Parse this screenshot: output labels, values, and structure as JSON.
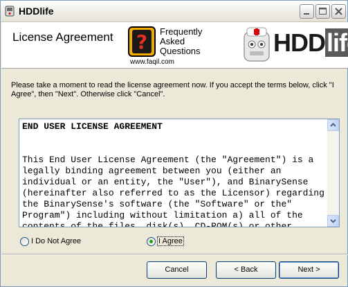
{
  "window": {
    "title": "HDDlife"
  },
  "header": {
    "title": "License Agreement",
    "faq": {
      "line1": "Frequently",
      "line2": "Asked",
      "line3": "Questions",
      "url": "www.faqil.com"
    },
    "logo": {
      "hdd": "HDD",
      "life": "life"
    }
  },
  "instructions": "Please take a moment to read the license agreement now. If you accept the terms below, click \"I Agree\", then \"Next\". Otherwise click \"Cancel\".",
  "license": {
    "title": "END USER LICENSE AGREEMENT",
    "body": "This End User License Agreement (the \"Agreement\") is a legally binding agreement between you (either an individual or an entity, the \"User\"), and BinarySense (hereinafter also referred to as the Licensor) regarding the BinarySense's software (the \"Software\" or the\" Program\") including without limitation a) all of the contents of the files, disk(s), CD-ROM(s) or other"
  },
  "options": {
    "disagree": "I Do Not Agree",
    "agree": "I Agree",
    "selected": "agree"
  },
  "buttons": {
    "cancel": "Cancel",
    "back": "< Back",
    "next": "Next >"
  },
  "colors": {
    "accent": "#003c74",
    "radio_check": "#21a121",
    "logo_life_bg": "#5a5a5a"
  },
  "icons": {
    "title": "hdd-icon",
    "minimize": "minimize-icon",
    "maximize": "maximize-icon",
    "close": "close-icon",
    "faq": "faq-question-icon",
    "logo": "hdd-mascot-icon"
  }
}
